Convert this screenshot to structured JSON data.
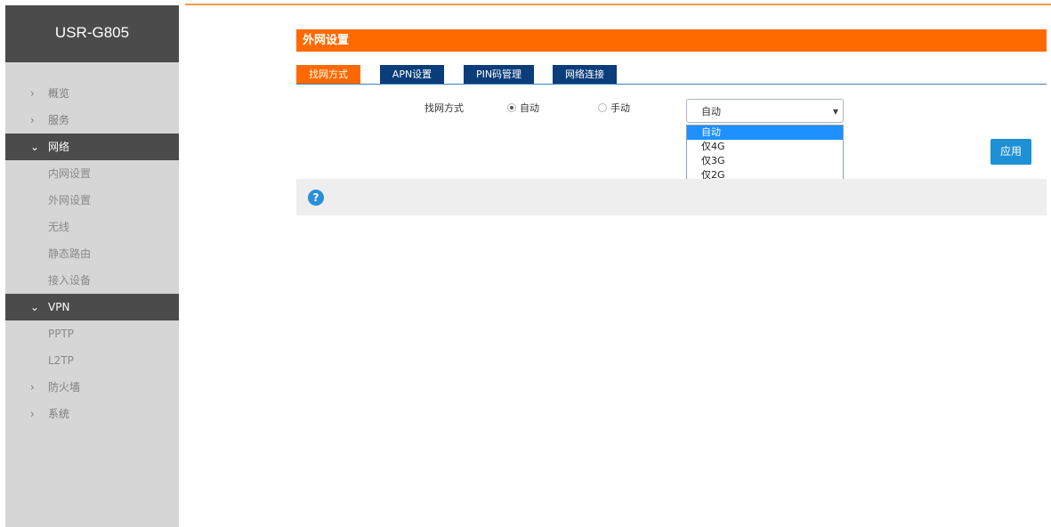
{
  "brand": "USR-G805",
  "sidebar": {
    "items": [
      {
        "label": "概览",
        "chev": "›"
      },
      {
        "label": "服务",
        "chev": "›"
      },
      {
        "label": "网络",
        "chev": "⌄"
      },
      {
        "label": "内网设置"
      },
      {
        "label": "外网设置"
      },
      {
        "label": "无线"
      },
      {
        "label": "静态路由"
      },
      {
        "label": "接入设备"
      },
      {
        "label": "VPN",
        "chev": "⌄"
      },
      {
        "label": "PPTP"
      },
      {
        "label": "L2TP"
      },
      {
        "label": "防火墙",
        "chev": "›"
      },
      {
        "label": "系统",
        "chev": "›"
      }
    ]
  },
  "page": {
    "title": "外网设置",
    "tabs": [
      "找网方式",
      "APN设置",
      "PIN码管理",
      "网络连接"
    ]
  },
  "form": {
    "label": "找网方式",
    "radio_auto": "自动",
    "radio_manual": "手动",
    "select_value": "自动",
    "select_arrow": "▼",
    "options": [
      "自动",
      "仅4G",
      "仅3G",
      "仅2G"
    ],
    "apply": "应用"
  },
  "help": {
    "icon": "?"
  },
  "colors": {
    "accent": "#ff6a00",
    "tab_blue": "#0a3d7a",
    "button_blue": "#1e90d6",
    "sidebar_dark": "#4b4b4b"
  }
}
